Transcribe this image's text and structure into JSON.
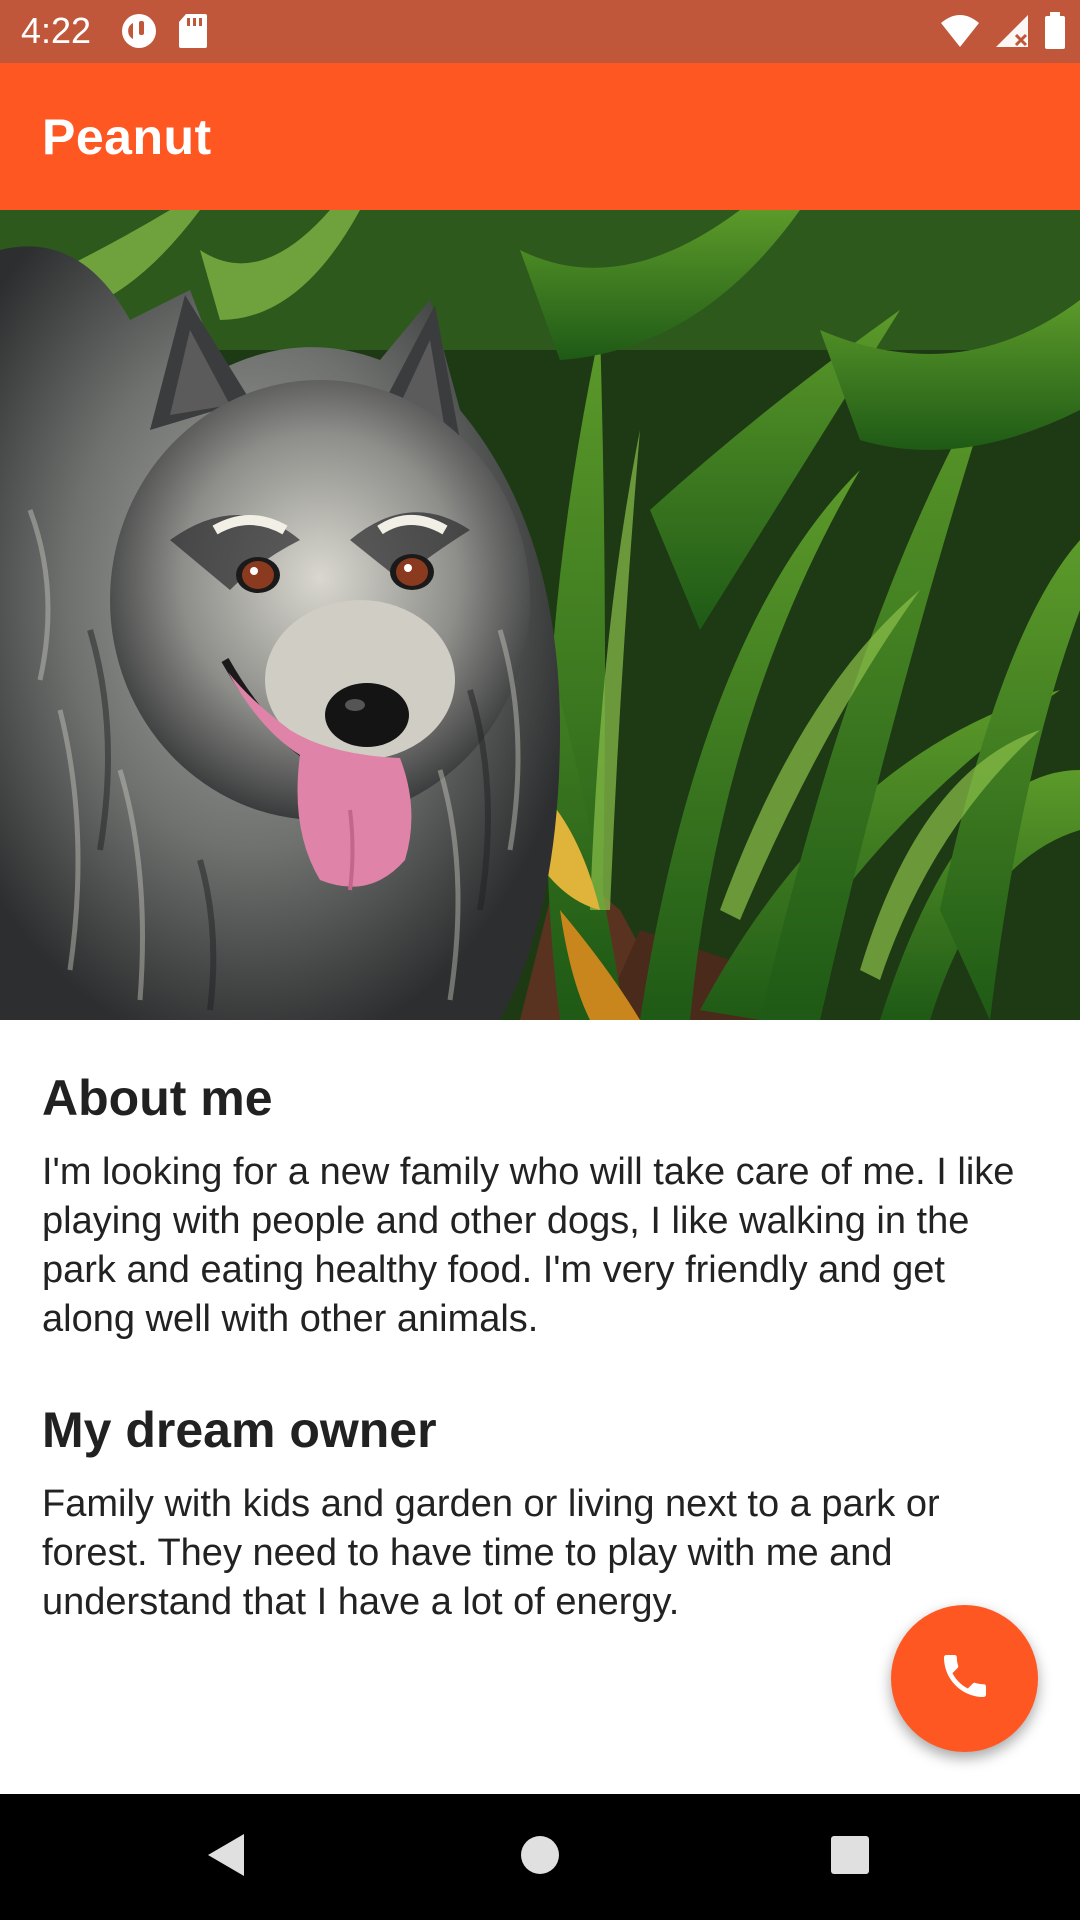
{
  "status_bar": {
    "time": "4:22",
    "left_icons": [
      "sync-icon",
      "sd-card-icon"
    ],
    "right_icons": [
      "wifi-icon",
      "cell-signal-icon",
      "battery-icon"
    ]
  },
  "app_bar": {
    "title": "Peanut"
  },
  "hero": {
    "image": "dog-photo"
  },
  "sections": [
    {
      "heading": "About me",
      "body": "I'm looking for a new family who will take care of me. I like playing with people and other dogs, I like walking in the park and eating healthy food. I'm very friendly and get along well with other animals."
    },
    {
      "heading": "My dream owner",
      "body": "Family with kids and garden or living next to a park or forest. They need to have time to play with me and understand that I have a lot of energy."
    }
  ],
  "fab": {
    "icon": "phone-icon"
  },
  "nav_bar": {
    "buttons": [
      "back-icon",
      "home-icon",
      "recents-icon"
    ]
  },
  "colors": {
    "status_bar": "#c1573a",
    "app_bar": "#ff5722",
    "fab": "#ff5722",
    "text_primary": "#212121",
    "nav_bar": "#000000"
  }
}
